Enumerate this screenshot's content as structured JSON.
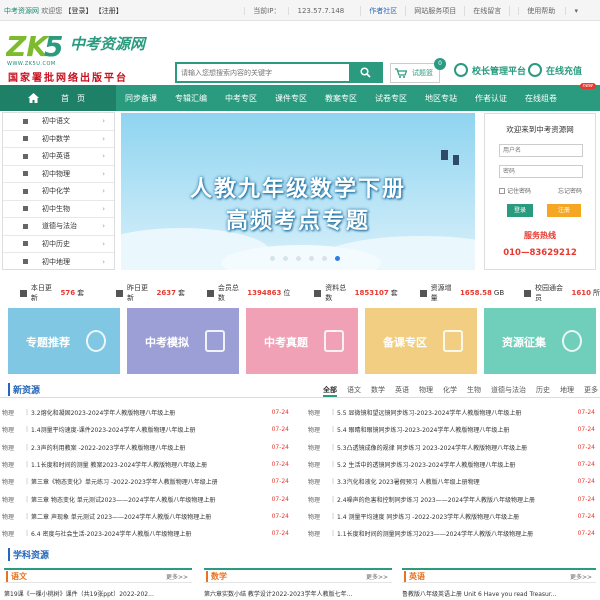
{
  "topbar": {
    "site": "中考资源网",
    "welcome": "欢迎您",
    "login": "【登录】",
    "register": "【注册】",
    "ip_label": "当前IP：",
    "ip_value": "123.57.7.148",
    "links": [
      "作者社区",
      "网站服务项目",
      "在线留言",
      "使用帮助"
    ]
  },
  "header": {
    "logo_text": "中考资源网",
    "logo_url": "WWW.ZK5U.COM",
    "logo_tagline": "国家署批网络出版平台",
    "search_placeholder": "请输入您想搜索内容的关键字",
    "cart_label": "试题篮",
    "cart_count": "0",
    "school_platform": "校长管理平台",
    "recharge": "在线充值"
  },
  "nav": {
    "home": "首　页",
    "items": [
      "同步备课",
      "专辑汇编",
      "中考专区",
      "课件专区",
      "教案专区",
      "试卷专区",
      "地区专站",
      "作者认证",
      "在线组卷"
    ],
    "new_tag": "new"
  },
  "sidebar": {
    "items": [
      "初中语文",
      "初中数学",
      "初中英语",
      "初中物理",
      "初中化学",
      "初中生物",
      "道德与法治",
      "初中历史",
      "初中地理"
    ]
  },
  "banner": {
    "line1": "人教九年级数学下册",
    "line2": "高频考点专题",
    "dots": 6,
    "active_dot": 5
  },
  "login": {
    "welcome": "欢迎来到中考资源网",
    "user_placeholder": "用户名",
    "pass_placeholder": "密码",
    "remember": "记住密码",
    "forgot": "忘记密码",
    "login_btn": "登录",
    "register_btn": "注册",
    "hotline_label": "服务热线",
    "hotline": "010—83629212"
  },
  "stats": [
    {
      "label": "本日更新",
      "value": "576",
      "unit": "套"
    },
    {
      "label": "昨日更新",
      "value": "2637",
      "unit": "套"
    },
    {
      "label": "会员总数",
      "value": "1394863",
      "unit": "位"
    },
    {
      "label": "资料总数",
      "value": "1853107",
      "unit": "套"
    },
    {
      "label": "资源增量",
      "value": "1658.58",
      "unit": "GB"
    },
    {
      "label": "校园通会员",
      "value": "1610",
      "unit": "所"
    }
  ],
  "categories": [
    {
      "label": "专题推荐",
      "color": "#7fc7e2"
    },
    {
      "label": "中考模拟",
      "color": "#9c9fd6"
    },
    {
      "label": "中考真题",
      "color": "#f0a1b6"
    },
    {
      "label": "备课专区",
      "color": "#f2ce82"
    },
    {
      "label": "资源征集",
      "color": "#6fcfbb"
    }
  ],
  "new_resources": {
    "title": "新资源",
    "tabs": [
      "全部",
      "语文",
      "数学",
      "英语",
      "物理",
      "化学",
      "生物",
      "道德与法治",
      "历史",
      "地理",
      "更多"
    ],
    "left": [
      {
        "subject": "物理",
        "title": "3.2熔化和凝固2023-2024学年人教版物理八年级上册",
        "date": "07-24"
      },
      {
        "subject": "物理",
        "title": "1.4测量平均速度-课件2023-2024学年人教版物理八年级上册",
        "date": "07-24"
      },
      {
        "subject": "物理",
        "title": "2.3声的利用教案 -2022-2023学年人教版物理八年级上册",
        "date": "07-24"
      },
      {
        "subject": "物理",
        "title": "1.1长度和时间的测量 教案2023-2024学年人教版物理八年级上册",
        "date": "07-24"
      },
      {
        "subject": "物理",
        "title": "第三章《物态变化》单元练习 -2022-2023学年人教版物理八年级上册",
        "date": "07-24"
      },
      {
        "subject": "物理",
        "title": "第三章 物态变化 单元测试2023——2024学年人教版八年级物理上册",
        "date": "07-24"
      },
      {
        "subject": "物理",
        "title": "第二章 声现象 单元测试 2023——2024学年人教版八年级物理上册",
        "date": "07-24"
      },
      {
        "subject": "物理",
        "title": "6.4 密度与社会生活-2023-2024学年人教版八年级物理上册",
        "date": "07-24"
      }
    ],
    "right": [
      {
        "subject": "物理",
        "title": "5.5 显微镜和望远镜同步练习-2023-2024学年人教版物理八年级上册",
        "date": "07-24"
      },
      {
        "subject": "物理",
        "title": "5.4 眼睛和眼镜同步练习-2023-2024学年人教版物理八年级上册",
        "date": "07-24"
      },
      {
        "subject": "物理",
        "title": "5.3凸透镜成像的规律 同步练习 2023-2024学年人教版物理八年级上册",
        "date": "07-24"
      },
      {
        "subject": "物理",
        "title": "5.2 生活中的透镜同步练习-2023-2024学年人教版物理八年级上册",
        "date": "07-24"
      },
      {
        "subject": "物理",
        "title": "3.3汽化和液化 2023暑假预习 人教版八年级上册物理",
        "date": "07-24"
      },
      {
        "subject": "物理",
        "title": "2.4噪声的危害和控制同步练习 2023——2024学年人教版八年级物理上册",
        "date": "07-24"
      },
      {
        "subject": "物理",
        "title": "1.4 测量平均速度 同步练习 -2022-2023学年人教版物理八年级上册",
        "date": "07-24"
      },
      {
        "subject": "物理",
        "title": "1.1长度和时间的测量同步练习2023——2024学年人教版八年级物理上册",
        "date": "07-24"
      }
    ]
  },
  "subject_resources": {
    "title": "学科资源",
    "more": "更多>>",
    "columns": [
      {
        "name": "语文",
        "first": "第19课《一棵小桃树》课件（共19张ppt）2022-202..."
      },
      {
        "name": "数学",
        "first": "第六章实数小结 教学设计2022-2023学年人教版七年..."
      },
      {
        "name": "英语",
        "first": "鲁教版八年级英语上册 Unit 6 Have you read Treasur..."
      }
    ]
  }
}
